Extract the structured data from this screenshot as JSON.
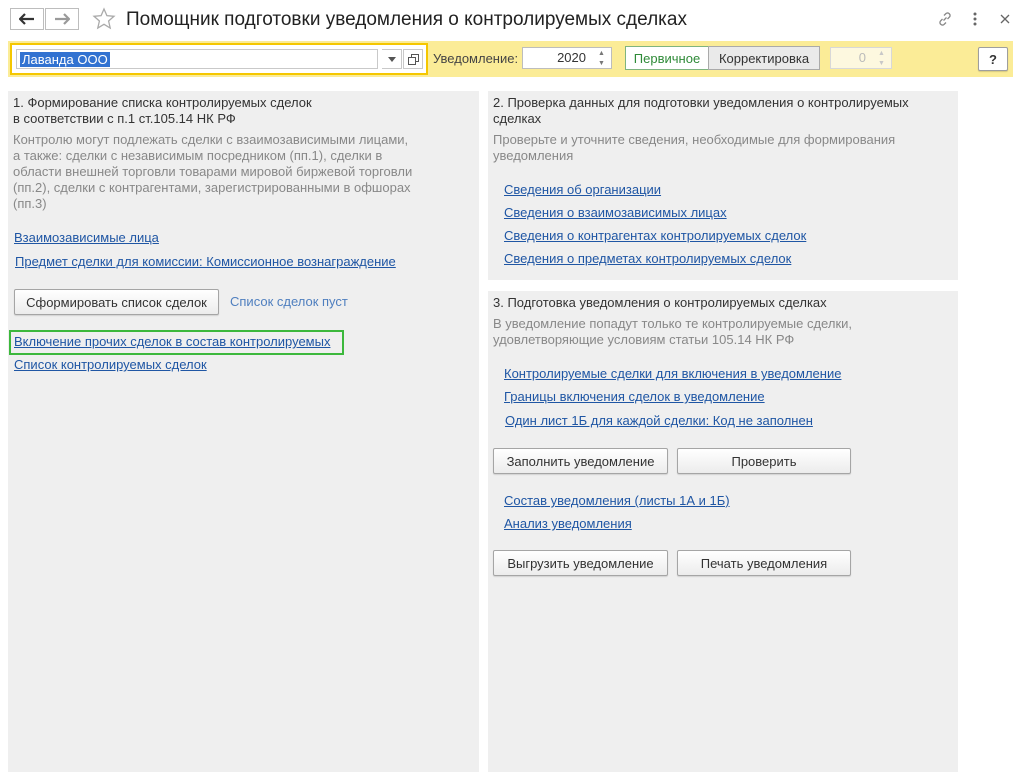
{
  "window": {
    "title": "Помощник подготовки уведомления о контролируемых сделках"
  },
  "toolbar": {
    "organization": "Лаванда ООО",
    "notice_label": "Уведомление:",
    "year": "2020",
    "type_primary": "Первичное",
    "type_correction": "Корректировка",
    "correction_number": "0",
    "help_label": "?"
  },
  "section1": {
    "heading": [
      "1. Формирование списка контролируемых сделок",
      "в соответствии с п.1 ст.105.14 НК РФ"
    ],
    "description": [
      "Контролю могут подлежать сделки с взаимозависимыми лицами,",
      "а также: сделки с независимым посредником (пп.1), сделки в",
      "области внешней торговли товарами мировой биржевой торговли",
      "(пп.2), сделки с контрагентами, зарегистрированными в офшорах",
      "(пп.3)"
    ],
    "link_related": "Взаимозависимые лица",
    "link_subject": "Предмет сделки для комиссии: Комиссионное вознаграждение",
    "button_form": "Сформировать список сделок",
    "status_text": "Список сделок пуст",
    "link_include_other": "Включение прочих сделок в состав контролируемых",
    "link_controlled_list": "Список контролируемых сделок"
  },
  "section2": {
    "heading": [
      "2. Проверка данных для подготовки уведомления о контролируемых",
      "сделках"
    ],
    "description": [
      "Проверьте и уточните сведения, необходимые для формирования",
      "уведомления"
    ],
    "links": [
      "Сведения об организации",
      "Сведения о взаимозависимых лицах",
      "Сведения о контрагентах контролируемых сделок",
      "Сведения о предметах контролируемых сделок"
    ]
  },
  "section3": {
    "heading": "3. Подготовка уведомления о контролируемых сделках",
    "description": [
      "В уведомление попадут только те контролируемые сделки,",
      "удовлетворяющие условиям статьи 105.14 НК РФ"
    ],
    "links": [
      "Контролируемые сделки для включения в уведомление",
      "Границы включения сделок в уведомление",
      "Один лист 1Б для каждой сделки: Код не заполнен"
    ],
    "button_fill": "Заполнить уведомление",
    "button_check": "Проверить",
    "link_composition": "Состав уведомления (листы 1А и 1Б)",
    "link_analysis": "Анализ уведомления",
    "button_export": "Выгрузить уведомление",
    "button_print": "Печать уведомления"
  },
  "colors": {
    "toolbar_bg": "#fbec97",
    "link": "#1f56a4",
    "active_green": "#2e8a37",
    "highlight_frame": "#3cb83c"
  }
}
